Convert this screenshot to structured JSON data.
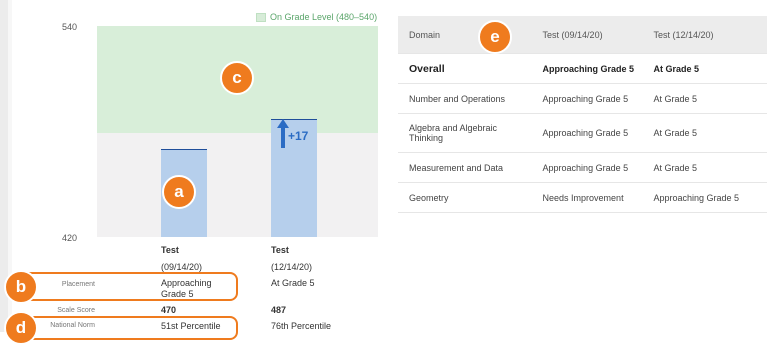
{
  "chart": {
    "legend_label": "On Grade Level (480–540)",
    "y_top_tick": "540",
    "y_bottom_tick": "420",
    "delta_label": "+17",
    "chart_data": {
      "type": "bar",
      "categories": [
        "Test (09/14/20)",
        "Test (12/14/20)"
      ],
      "values": [
        470,
        487
      ],
      "ylim": [
        420,
        540
      ],
      "reference_band": {
        "label": "On Grade Level (480–540)",
        "from": 480,
        "to": 540,
        "color": "#d8eed9"
      },
      "bar_color": "#b6cfec"
    }
  },
  "columns": [
    {
      "title": "Test",
      "date": "(09/14/20)",
      "placement": "Approaching Grade 5",
      "scale_score": "470",
      "national_norm": "51st Percentile"
    },
    {
      "title": "Test",
      "date": "(12/14/20)",
      "placement": "At Grade 5",
      "scale_score": "487",
      "national_norm": "76th Percentile"
    }
  ],
  "row_labels": {
    "placement": "Placement",
    "scale_score": "Scale Score",
    "national_norm": "National Norm"
  },
  "markers": {
    "a": "a",
    "b": "b",
    "c": "c",
    "d": "d",
    "e": "e"
  },
  "table": {
    "headers": [
      "Domain",
      "Test (09/14/20)",
      "Test (12/14/20)"
    ],
    "rows": [
      [
        "Overall",
        "Approaching Grade 5",
        "At Grade 5"
      ],
      [
        "Number and Operations",
        "Approaching Grade 5",
        "At Grade 5"
      ],
      [
        "Algebra and Algebraic Thinking",
        "Approaching Grade 5",
        "At Grade 5"
      ],
      [
        "Measurement and Data",
        "Approaching Grade 5",
        "At Grade 5"
      ],
      [
        "Geometry",
        "Needs Improvement",
        "Approaching Grade 5"
      ]
    ]
  }
}
